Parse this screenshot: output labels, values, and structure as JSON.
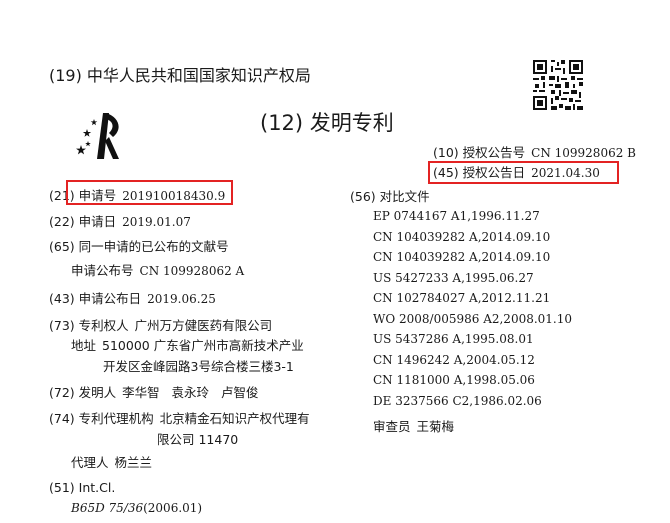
{
  "header": {
    "office": "(19) 中华人民共和国国家知识产权局",
    "doc_type": "(12) 发明专利"
  },
  "grant": {
    "pub_no_label": "(10) 授权公告号",
    "pub_no_value": "CN 109928062 B",
    "pub_date_label": "(45) 授权公告日",
    "pub_date_value": "2021.04.30"
  },
  "left": {
    "app_no_prefix": "(21)",
    "app_no_label": "申请号",
    "app_no_value": "201910018430.9",
    "app_date_label": "(22) 申请日",
    "app_date_value": "2019.01.07",
    "same_app_label": "(65) 同一申请的已公布的文献号",
    "app_pub_no_label": "申请公布号",
    "app_pub_no_value": "CN 109928062 A",
    "app_pub_date_label": "(43) 申请公布日",
    "app_pub_date_value": "2019.06.25",
    "patentee_label": "(73) 专利权人",
    "patentee_value": "广州万方健医药有限公司",
    "address_label": "地址",
    "address_line1": "510000 广东省广州市高新技术产业",
    "address_line2": "开发区金峰园路3号综合楼三楼3-1",
    "inventors_label": "(72) 发明人",
    "inventors_value": "李华智   袁永玲   卢智俊",
    "agency_label": "(74) 专利代理机构",
    "agency_line1": "北京精金石知识产权代理有",
    "agency_line2": "限公司 11470",
    "agent_label": "代理人",
    "agent_value": "杨兰兰",
    "intcl_label": "(51) Int.Cl.",
    "intcl_code": "B65D 75/36",
    "intcl_version": "(2006.01)"
  },
  "right": {
    "citations_label": "(56) 对比文件",
    "citations": [
      "EP 0744167 A1,1996.11.27",
      "CN 104039282 A,2014.09.10",
      "CN 104039282 A,2014.09.10",
      "US 5427233 A,1995.06.27",
      "CN 102784027 A,2012.11.21",
      "WO 2008/005986 A2,2008.01.10",
      "US 5437286 A,1995.08.01",
      "CN 1496242 A,2004.05.12",
      "CN 1181000 A,1998.05.06",
      "DE 3237566 C2,1986.02.06"
    ],
    "examiner_label": "审查员",
    "examiner_value": "王菊梅"
  },
  "colors": {
    "highlight_box": "#e32323",
    "text": "#1a1a1a"
  },
  "icons": {
    "qr": "qr-code-icon",
    "logo": "cnipa-logo-icon"
  }
}
